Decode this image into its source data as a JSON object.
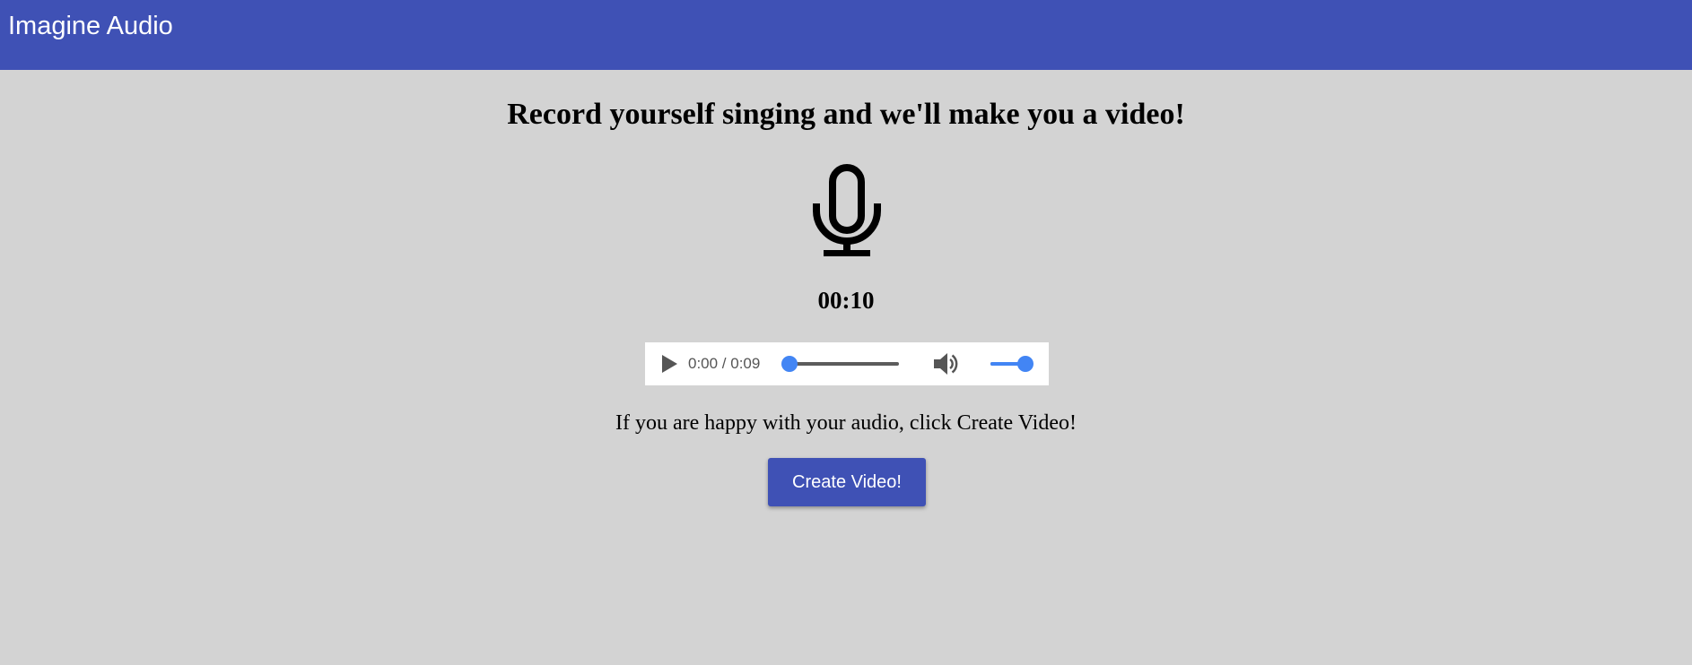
{
  "app_bar": {
    "title": "Imagine Audio",
    "color": "#3f51b5"
  },
  "main": {
    "heading": "Record yourself singing and we'll make you a video!",
    "mic_icon": "microphone-icon",
    "timer": "00:10",
    "audio_player": {
      "play_icon": "play-icon",
      "time_display": "0:00 / 0:09",
      "progress_fraction": 0.0,
      "volume_icon": "volume-icon",
      "volume_fraction": 1.0,
      "accent_color": "#4285f4"
    },
    "instruction": "If you are happy with your audio, click Create Video!",
    "create_button_label": "Create Video!"
  }
}
